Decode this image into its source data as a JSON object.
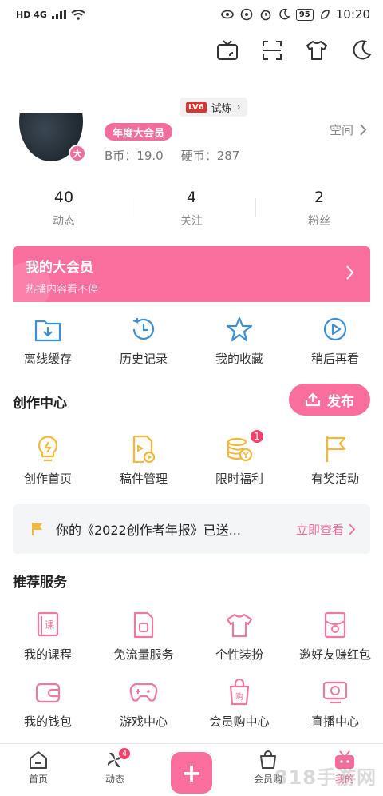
{
  "status_bar": {
    "left": "HD 4G",
    "battery": "95",
    "time": "10:20"
  },
  "top_icons": [
    "tv-cast-icon",
    "scan-icon",
    "tshirt-icon",
    "moon-icon"
  ],
  "level": {
    "badge": "LV6",
    "label": "试炼"
  },
  "profile": {
    "avatar_badge": "大",
    "vip_tag": "年度大会员",
    "bcoin": "B币：19.0",
    "coin": "硬币：287",
    "space": "空间"
  },
  "stats": [
    {
      "num": "40",
      "label": "动态"
    },
    {
      "num": "4",
      "label": "关注"
    },
    {
      "num": "2",
      "label": "粉丝"
    }
  ],
  "vip_banner": {
    "title": "我的大会员",
    "subtitle": "热播内容看不停"
  },
  "quick": [
    {
      "label": "离线缓存",
      "icon": "download-folder-icon"
    },
    {
      "label": "历史记录",
      "icon": "history-clock-icon"
    },
    {
      "label": "我的收藏",
      "icon": "star-icon"
    },
    {
      "label": "稍后再看",
      "icon": "watch-later-icon"
    }
  ],
  "creator": {
    "title": "创作中心",
    "publish": "发布",
    "items": [
      {
        "label": "创作首页",
        "icon": "lightbulb-icon"
      },
      {
        "label": "稿件管理",
        "icon": "manuscript-icon"
      },
      {
        "label": "限时福利",
        "icon": "coin-stack-icon",
        "badge": "1"
      },
      {
        "label": "有奖活动",
        "icon": "flag-icon"
      }
    ],
    "report": {
      "text": "你的《2022创作者年报》已送...",
      "action": "立即查看"
    }
  },
  "services": {
    "title": "推荐服务",
    "row1": [
      {
        "label": "我的课程",
        "icon": "course-icon"
      },
      {
        "label": "免流量服务",
        "icon": "sim-card-icon"
      },
      {
        "label": "个性装扮",
        "icon": "tshirt-icon"
      },
      {
        "label": "邀好友赚红包",
        "icon": "invite-icon"
      }
    ],
    "row2": [
      {
        "label": "我的钱包",
        "icon": "wallet-icon"
      },
      {
        "label": "游戏中心",
        "icon": "gamepad-icon"
      },
      {
        "label": "会员购中心",
        "icon": "shopping-bag-icon"
      },
      {
        "label": "直播中心",
        "icon": "live-icon"
      }
    ]
  },
  "tabbar": [
    {
      "label": "首页",
      "icon": "home-icon"
    },
    {
      "label": "动态",
      "icon": "pinwheel-icon",
      "badge": "4"
    },
    {
      "label": "",
      "icon": "plus-icon"
    },
    {
      "label": "会员购",
      "icon": "shopping-bag-icon"
    },
    {
      "label": "我的",
      "icon": "tv-icon"
    }
  ],
  "watermark": "818手游网",
  "colors": {
    "accent": "#fb6f9f",
    "blue_icon": "#3b8fd4",
    "yellow_icon": "#f3b83a"
  }
}
